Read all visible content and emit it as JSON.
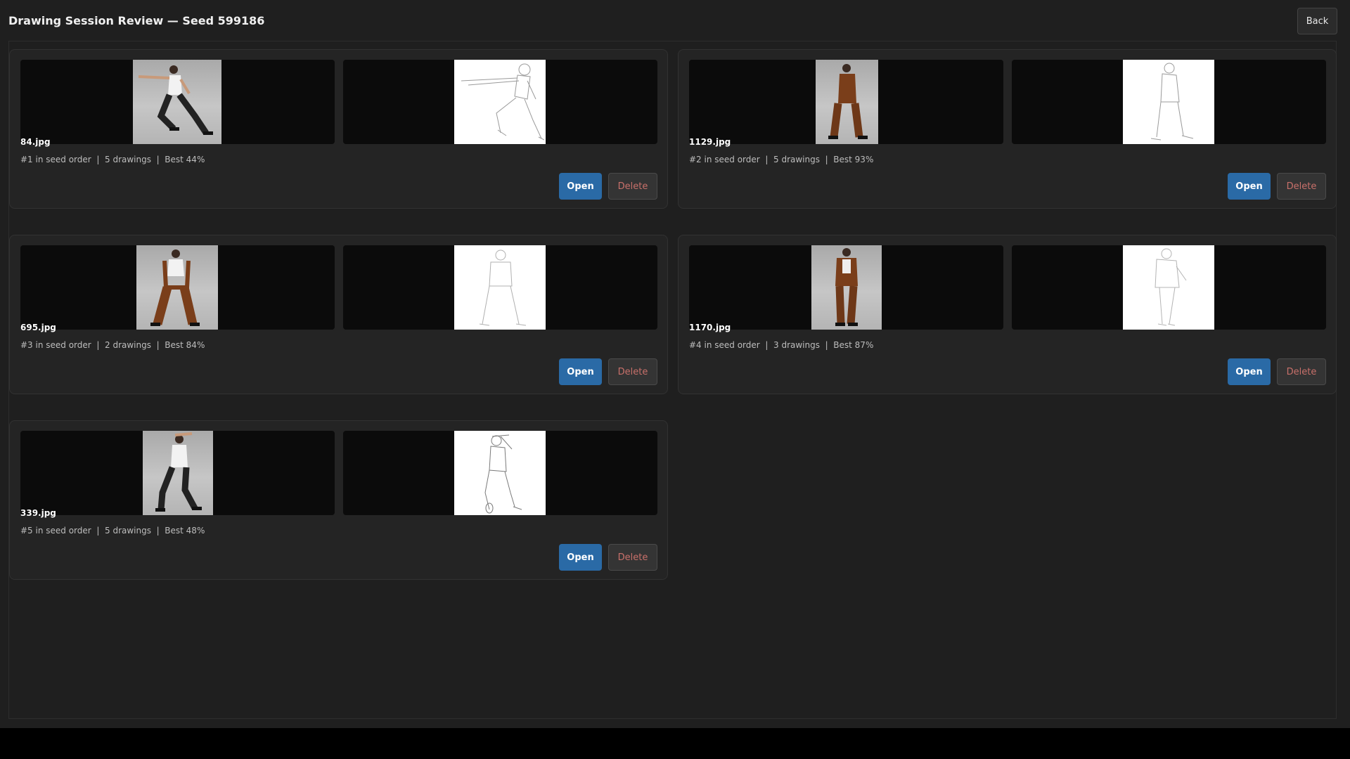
{
  "header": {
    "title": "Drawing Session Review — Seed 599186",
    "back_label": "Back"
  },
  "colors": {
    "background": "#1f1f1f",
    "card": "#242424",
    "open_button": "#2a6aa6",
    "delete_text": "#c8706a"
  },
  "cards": [
    {
      "filename": "84.jpg",
      "meta": "#1 in seed order  |  5 drawings  |  Best 44%",
      "open_label": "Open",
      "delete_label": "Delete"
    },
    {
      "filename": "1129.jpg",
      "meta": "#2 in seed order  |  5 drawings  |  Best 93%",
      "open_label": "Open",
      "delete_label": "Delete"
    },
    {
      "filename": "695.jpg",
      "meta": "#3 in seed order  |  2 drawings  |  Best 84%",
      "open_label": "Open",
      "delete_label": "Delete"
    },
    {
      "filename": "1170.jpg",
      "meta": "#4 in seed order  |  3 drawings  |  Best 87%",
      "open_label": "Open",
      "delete_label": "Delete"
    },
    {
      "filename": "339.jpg",
      "meta": "#5 in seed order  |  5 drawings  |  Best 48%",
      "open_label": "Open",
      "delete_label": "Delete"
    }
  ]
}
